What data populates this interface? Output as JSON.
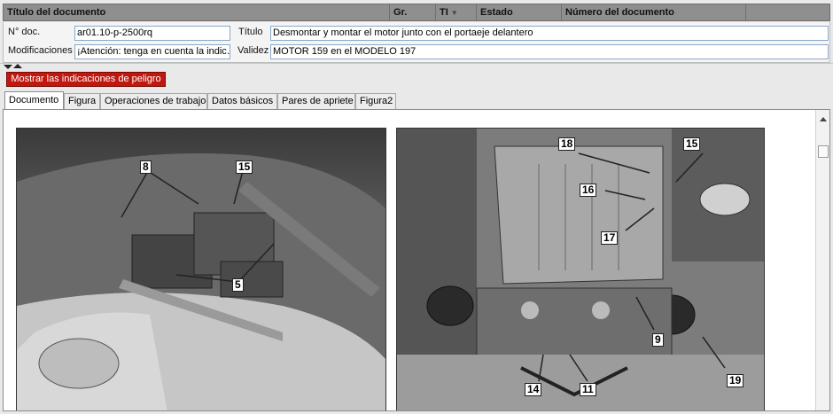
{
  "header": {
    "col_title": "Título del documento",
    "col_group": "Gr.",
    "col_ti": "TI",
    "col_ti_sort_icon": "sort-desc-icon",
    "col_status": "Estado",
    "col_docnum": "Número del documento"
  },
  "meta": {
    "docnum_label": "N° doc.",
    "docnum_value": "ar01.10-p-2500rq",
    "title_label": "Título",
    "title_value": "Desmontar y montar el motor junto con el portaeje delantero",
    "mods_label": "Modificaciones",
    "mods_value": "¡Atención: tenga en cuenta la indic…",
    "validity_label": "Validez",
    "validity_value": "MOTOR 159 en el MODELO 197"
  },
  "danger_button": "Mostrar las indicaciones de peligro",
  "colors": {
    "danger": "#c0180f",
    "header": "#8f8f8f"
  },
  "tabs": [
    {
      "label": "Documento",
      "active": true
    },
    {
      "label": "Figura"
    },
    {
      "label": "Operaciones de trabajo"
    },
    {
      "label": "Datos básicos"
    },
    {
      "label": "Pares de apriete"
    },
    {
      "label": "Figura2"
    }
  ],
  "figures": {
    "left_callouts": [
      "8",
      "15",
      "5"
    ],
    "right_callouts": [
      "18",
      "15",
      "16",
      "17",
      "9",
      "19",
      "14",
      "11"
    ]
  }
}
